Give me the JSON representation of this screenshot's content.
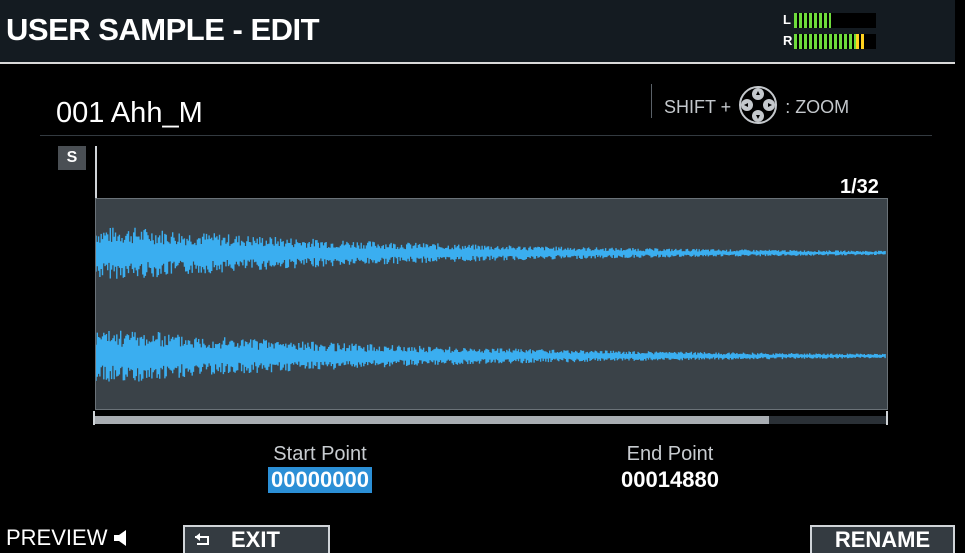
{
  "header": {
    "title": "USER SAMPLE - EDIT",
    "level_meter": {
      "left_label": "L",
      "right_label": "R",
      "left_level": 0.45,
      "right_level": 0.88,
      "right_peak_color": "#ffd21e",
      "level_color": "#6edb3c"
    }
  },
  "sample": {
    "name": "001 Ahh_M"
  },
  "zoom_hint": {
    "prefix": "SHIFT +",
    "icon": "dpad-icon",
    "suffix": ": ZOOM"
  },
  "waveform": {
    "start_marker": "S",
    "zoom_ratio": "1/32",
    "wave_color": "#3aaef0",
    "scroll_position": 0.85
  },
  "points": {
    "start": {
      "label": "Start Point",
      "value": "00000000",
      "selected": true,
      "highlight_color": "#2b8fd6"
    },
    "end": {
      "label": "End Point",
      "value": "00014880"
    }
  },
  "footer": {
    "preview_label": "PREVIEW",
    "preview_icon": "speaker-icon",
    "exit_label": "EXIT",
    "exit_icon": "return-arrow-icon",
    "rename_label": "RENAME"
  }
}
